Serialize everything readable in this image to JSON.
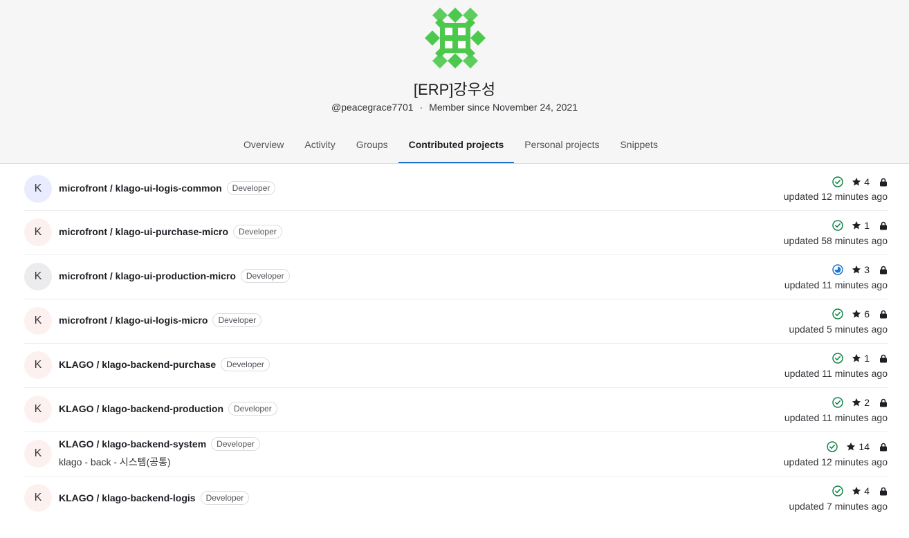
{
  "profile": {
    "name": "[ERP]강우성",
    "username": "@peacegrace7701",
    "separator": "·",
    "member_since": "Member since November 24, 2021",
    "avatar_color": "#4cc94c"
  },
  "tabs": [
    {
      "label": "Overview"
    },
    {
      "label": "Activity"
    },
    {
      "label": "Groups"
    },
    {
      "label": "Contributed projects",
      "active": true
    },
    {
      "label": "Personal projects"
    },
    {
      "label": "Snippets"
    }
  ],
  "projects": [
    {
      "avatar": "K",
      "title": "microfront / klago-ui-logis-common",
      "role": "Developer",
      "stars": "4",
      "updated": "updated 12 minutes ago",
      "pipeline": "passed"
    },
    {
      "avatar": "K",
      "title": "microfront / klago-ui-purchase-micro",
      "role": "Developer",
      "stars": "1",
      "updated": "updated 58 minutes ago",
      "pipeline": "passed"
    },
    {
      "avatar": "K",
      "title": "microfront / klago-ui-production-micro",
      "role": "Developer",
      "stars": "3",
      "updated": "updated 11 minutes ago",
      "pipeline": "running"
    },
    {
      "avatar": "K",
      "title": "microfront / klago-ui-logis-micro",
      "role": "Developer",
      "stars": "6",
      "updated": "updated 5 minutes ago",
      "pipeline": "passed"
    },
    {
      "avatar": "K",
      "title": "KLAGO / klago-backend-purchase",
      "role": "Developer",
      "stars": "1",
      "updated": "updated 11 minutes ago",
      "pipeline": "passed"
    },
    {
      "avatar": "K",
      "title": "KLAGO / klago-backend-production",
      "role": "Developer",
      "stars": "2",
      "updated": "updated 11 minutes ago",
      "pipeline": "passed"
    },
    {
      "avatar": "K",
      "title": "KLAGO / klago-backend-system",
      "role": "Developer",
      "description": "klago - back - 시스템(공통)",
      "stars": "14",
      "updated": "updated 12 minutes ago",
      "pipeline": "passed"
    },
    {
      "avatar": "K",
      "title": "KLAGO / klago-backend-logis",
      "role": "Developer",
      "stars": "4",
      "updated": "updated 7 minutes ago",
      "pipeline": "passed"
    }
  ],
  "colors": {
    "passed": "#108548",
    "running": "#1f75cb",
    "tab_underline": "#1f75cb"
  }
}
